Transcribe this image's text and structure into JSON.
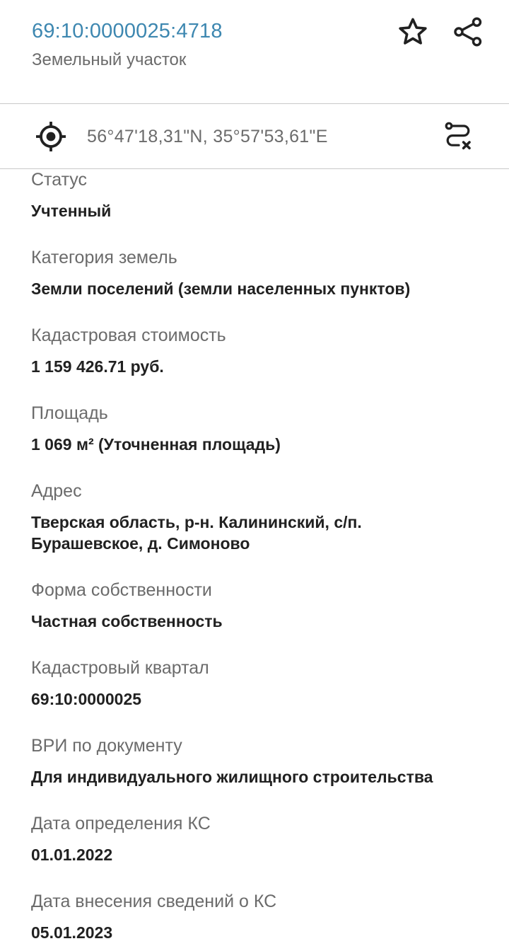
{
  "header": {
    "cadastral_number": "69:10:0000025:4718",
    "object_type": "Земельный участок",
    "icons": {
      "favorite": "star-icon",
      "share": "share-icon"
    }
  },
  "coords_bar": {
    "coordinates": "56°47'18,31\"N, 35°57'53,61\"E",
    "icons": {
      "locate": "crosshair-icon",
      "route": "route-clear-icon"
    }
  },
  "fields": [
    {
      "label": "Статус",
      "value": "Учтенный"
    },
    {
      "label": "Категория земель",
      "value": "Земли поселений (земли населенных пунктов)"
    },
    {
      "label": "Кадастровая стоимость",
      "value": "1 159 426.71 руб."
    },
    {
      "label": "Площадь",
      "value": "1 069 м² (Уточненная площадь)"
    },
    {
      "label": "Адрес",
      "value_lines": [
        "Тверская область, р-н. Калининский, с/п.",
        "Бурашевское, д. Симоново"
      ]
    },
    {
      "label": "Форма собственности",
      "value": "Частная собственность"
    },
    {
      "label": "Кадастровый квартал",
      "value": "69:10:0000025"
    },
    {
      "label": "ВРИ по документу",
      "value": "Для индивидуального жилищного строительства"
    },
    {
      "label": "Дата определения КС",
      "value": "01.01.2022"
    },
    {
      "label": "Дата внесения сведений о КС",
      "value": "05.01.2023"
    }
  ],
  "colors": {
    "accent": "#3d87b0",
    "label": "#6b6b6b",
    "value": "#212121",
    "divider": "#c9c9c9"
  }
}
